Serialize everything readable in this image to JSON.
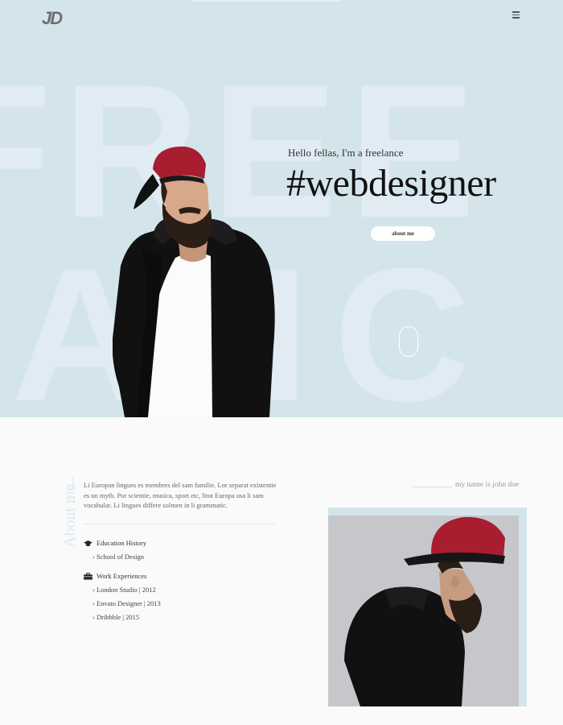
{
  "header": {
    "logo": "JD",
    "menu_icon": "hamburger-icon"
  },
  "hero": {
    "bg_text_line1": "FREE",
    "bg_text_line2": "ANC",
    "greeting": "Hello fellas, I'm a freelance",
    "headline": "#webdesigner",
    "about_button": "about me",
    "scroll_icon": "mouse-scroll-icon"
  },
  "about": {
    "vertical_title": "About me",
    "intro": "Li Europan lingues es membres del sam familie. Lor separat existentie es un myth. Por scientie, musica, sport etc, litot Europa usa li sam vocabular. Li lingues differe solmen in li grammatic.",
    "education": {
      "icon": "graduation-cap-icon",
      "title": "Education History",
      "items": [
        "School of Design"
      ]
    },
    "work": {
      "icon": "briefcase-icon",
      "title": "Work Experiences",
      "items": [
        "London Studio | 2012",
        "Envato Designer | 2013",
        "Dribbble | 2015"
      ]
    },
    "name_label": "my name is john doe"
  },
  "colors": {
    "hero_bg": "#d3e5ea",
    "bg_text": "#e1ebf4",
    "page_bg": "#fafafa",
    "cap_red": "#a81d30"
  }
}
